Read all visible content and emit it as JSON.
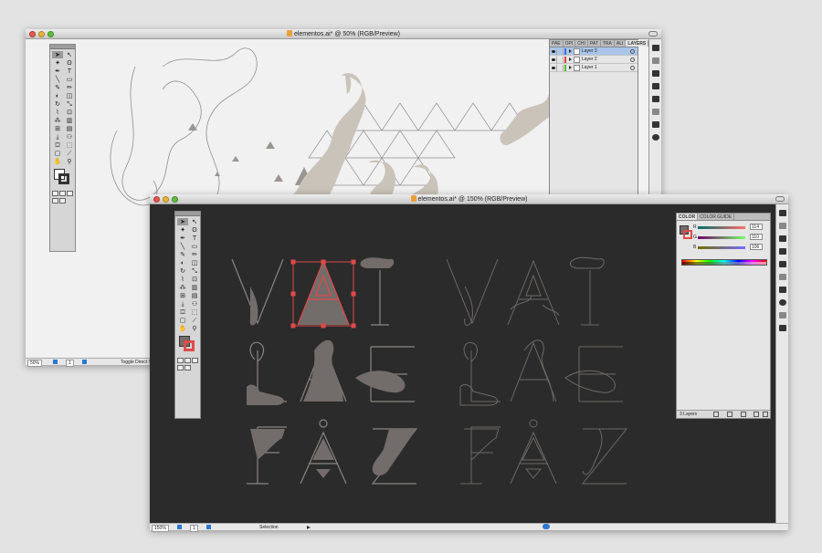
{
  "back_window": {
    "title": "elementos.ai* @ 50% (RGB/Preview)",
    "zoom": "50%",
    "page": "1",
    "status": "Toggle Direct S",
    "layers_panel": {
      "tabs": [
        "PAE",
        "OPI",
        "CHI",
        "PAT",
        "TRA",
        "ALI",
        "LAYERS"
      ],
      "layers": [
        {
          "name": "Layer 3",
          "color": "#3b6fe0",
          "active": true
        },
        {
          "name": "Layer 2",
          "color": "#e0443b",
          "active": false
        },
        {
          "name": "Layer 1",
          "color": "#4fbf3a",
          "active": false
        }
      ]
    }
  },
  "front_window": {
    "title": "elementos.ai* @ 150% (RGB/Preview)",
    "zoom": "150%",
    "page": "1",
    "status": "Selection",
    "canvas_bg": "#2b2b2b",
    "lettering": [
      [
        "V",
        "A",
        "I"
      ],
      [
        "L",
        "A",
        "E"
      ],
      [
        "F",
        "A",
        "Z"
      ]
    ],
    "color_panel": {
      "tabs": [
        "COLOR",
        "COLOR GUIDE"
      ],
      "channels": [
        {
          "label": "R",
          "value": "114"
        },
        {
          "label": "G",
          "value": "110"
        },
        {
          "label": "B",
          "value": "106"
        }
      ],
      "footer": "3 Layers"
    }
  },
  "colors": {
    "shape_fill": "#726d6a",
    "outline": "#8a8683",
    "selection": "#e04a4a"
  },
  "icons": {
    "tools": [
      "selection-tool-icon",
      "direct-selection-tool-icon",
      "magic-wand-icon",
      "lasso-icon",
      "pen-tool-icon",
      "type-tool-icon",
      "line-tool-icon",
      "rectangle-tool-icon",
      "paintbrush-icon",
      "pencil-icon",
      "blob-brush-icon",
      "eraser-icon",
      "rotate-icon",
      "scale-icon",
      "warp-icon",
      "free-transform-icon",
      "symbol-sprayer-icon",
      "graph-icon",
      "mesh-icon",
      "gradient-icon",
      "eyedropper-icon",
      "blend-icon",
      "live-paint-icon",
      "live-paint-selection-icon",
      "artboard-icon",
      "slice-icon",
      "hand-icon",
      "zoom-icon"
    ]
  }
}
